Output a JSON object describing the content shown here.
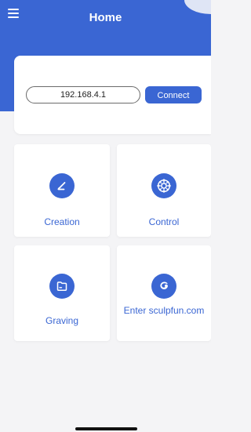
{
  "header": {
    "title": "Home",
    "menu_icon": "menu-icon"
  },
  "connection": {
    "ip_value": "192.168.4.1",
    "connect_label": "Connect"
  },
  "tiles": [
    {
      "icon": "pen-icon",
      "label": "Creation"
    },
    {
      "icon": "control-target-icon",
      "label": "Control"
    },
    {
      "icon": "folder-icon",
      "label": "Graving"
    },
    {
      "icon": "sculpfun-logo-icon",
      "label": "Enter sculpfun.com"
    }
  ],
  "colors": {
    "accent": "#3a66d3",
    "background": "#f4f4f6",
    "card": "#ffffff"
  }
}
